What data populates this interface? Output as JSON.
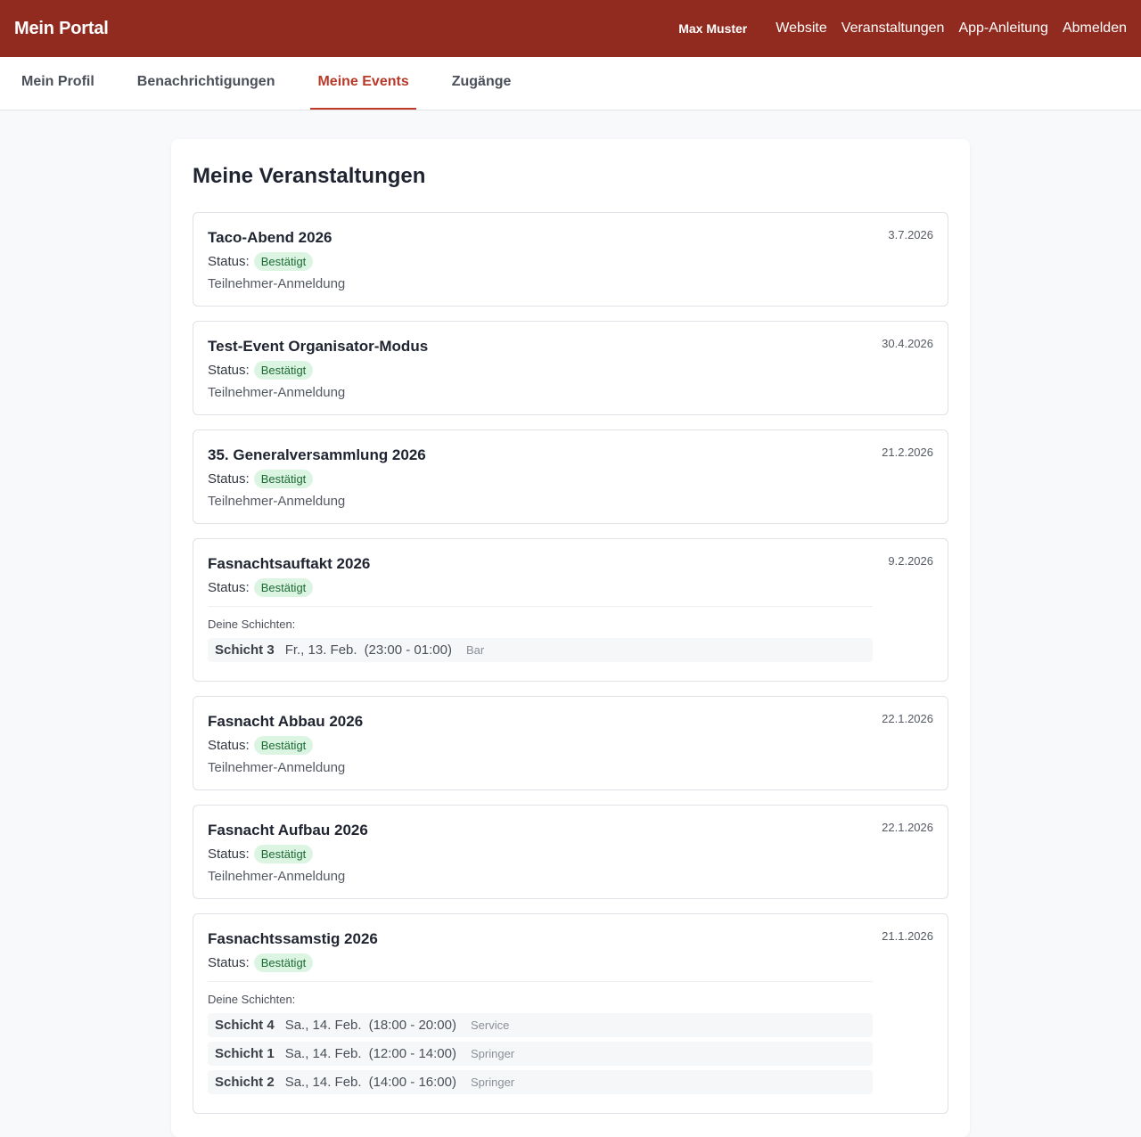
{
  "header": {
    "brand": "Mein Portal",
    "user": "Max Muster",
    "links": [
      "Website",
      "Veranstaltungen",
      "App-Anleitung",
      "Abmelden"
    ]
  },
  "tabs": [
    {
      "label": "Mein Profil",
      "active": false
    },
    {
      "label": "Benachrichtigungen",
      "active": false
    },
    {
      "label": "Meine Events",
      "active": true
    },
    {
      "label": "Zugänge",
      "active": false
    }
  ],
  "page": {
    "title": "Meine Veranstaltungen",
    "status_label": "Status:",
    "shifts_label": "Deine Schichten:"
  },
  "events": [
    {
      "title": "Taco-Abend 2026",
      "date": "3.7.2026",
      "status": "Bestätigt",
      "regtype": "Teilnehmer-Anmeldung"
    },
    {
      "title": "Test-Event Organisator-Modus",
      "date": "30.4.2026",
      "status": "Bestätigt",
      "regtype": "Teilnehmer-Anmeldung"
    },
    {
      "title": "35. Generalversammlung 2026",
      "date": "21.2.2026",
      "status": "Bestätigt",
      "regtype": "Teilnehmer-Anmeldung"
    },
    {
      "title": "Fasnachtsauftakt 2026",
      "date": "9.2.2026",
      "status": "Bestätigt",
      "shifts": [
        {
          "name": "Schicht 3",
          "day": "Fr., 13. Feb.",
          "time": "(23:00 - 01:00)",
          "role": "Bar"
        }
      ]
    },
    {
      "title": "Fasnacht Abbau 2026",
      "date": "22.1.2026",
      "status": "Bestätigt",
      "regtype": "Teilnehmer-Anmeldung"
    },
    {
      "title": "Fasnacht Aufbau 2026",
      "date": "22.1.2026",
      "status": "Bestätigt",
      "regtype": "Teilnehmer-Anmeldung"
    },
    {
      "title": "Fasnachtssamstig 2026",
      "date": "21.1.2026",
      "status": "Bestätigt",
      "shifts": [
        {
          "name": "Schicht 4",
          "day": "Sa., 14. Feb.",
          "time": "(18:00 - 20:00)",
          "role": "Service"
        },
        {
          "name": "Schicht 1",
          "day": "Sa., 14. Feb.",
          "time": "(12:00 - 14:00)",
          "role": "Springer"
        },
        {
          "name": "Schicht 2",
          "day": "Sa., 14. Feb.",
          "time": "(14:00 - 16:00)",
          "role": "Springer"
        }
      ]
    }
  ]
}
